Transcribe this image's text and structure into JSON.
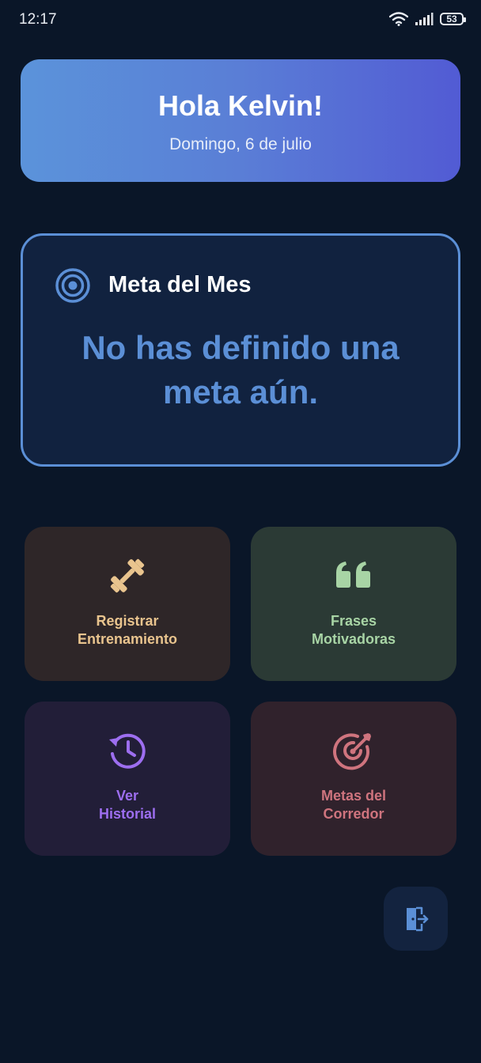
{
  "status_bar": {
    "time": "12:17",
    "battery": "53"
  },
  "greeting": {
    "title": "Hola Kelvin!",
    "date": "Domingo, 6 de julio"
  },
  "monthly_goal": {
    "title": "Meta del Mes",
    "empty_message": "No has definido una meta aún.",
    "icon": "target-icon"
  },
  "tiles": [
    {
      "line1": "Registrar",
      "line2": "Entrenamiento",
      "icon": "dumbbell-icon",
      "color": "#e9c48e"
    },
    {
      "line1": "Frases",
      "line2": "Motivadoras",
      "icon": "quote-icon",
      "color": "#a8d4a5"
    },
    {
      "line1": "Ver",
      "line2": "Historial",
      "icon": "history-icon",
      "color": "#9d6ef0"
    },
    {
      "line1": "Metas del",
      "line2": "Corredor",
      "icon": "target-arrow-icon",
      "color": "#cf747e"
    }
  ],
  "logout": {
    "icon": "logout-icon",
    "color": "#5b8fd6"
  },
  "colors": {
    "background": "#0a1628",
    "accent": "#5b8fd6",
    "gradient_start": "#5b93da",
    "gradient_end": "#525bd4"
  }
}
